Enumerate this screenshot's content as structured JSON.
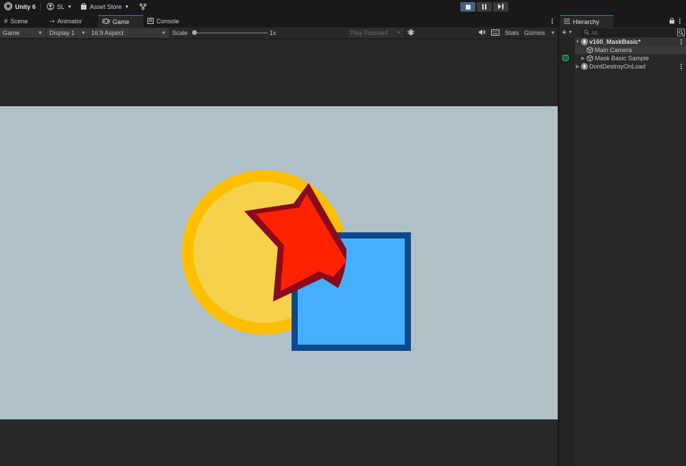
{
  "app": {
    "name": "Unity 6",
    "account": "SL",
    "asset_store": "Asset Store"
  },
  "playmode": {
    "buttons": [
      "stop",
      "pause",
      "step"
    ],
    "active": "stop"
  },
  "tabs": [
    {
      "label": "Scene",
      "icon": "grid-icon"
    },
    {
      "label": "Animator",
      "icon": "animator-icon"
    },
    {
      "label": "Game",
      "icon": "gamepad-icon",
      "active": true
    },
    {
      "label": "Console",
      "icon": "console-icon"
    }
  ],
  "game_toolbar": {
    "view_mode": "Game",
    "display": "Display 1",
    "aspect": "16:9 Aspect",
    "scale_label": "Scale",
    "scale_value": "1x",
    "play_focused": "Play Focused",
    "stats": "Stats",
    "gizmos": "Gizmos"
  },
  "scene_shapes": {
    "circle_color": "#f5d14c",
    "circle_outline": "#ffbf00",
    "star_color": "#ff2200",
    "star_outline": "#8a0a1e",
    "square_color": "#44b0fb",
    "square_outline": "#0e478a",
    "background": "#afc1c6"
  },
  "hierarchy": {
    "title": "Hierarchy",
    "search_placeholder": "All",
    "items": [
      {
        "label": "v160_MaskBasic*",
        "depth": 0,
        "expanded": true,
        "type": "scene"
      },
      {
        "label": "Main Camera",
        "depth": 1,
        "type": "gameobject"
      },
      {
        "label": "Mask Basic Sample",
        "depth": 1,
        "type": "gameobject",
        "collapsed": true
      },
      {
        "label": "DontDestroyOnLoad",
        "depth": 0,
        "collapsed": true,
        "type": "scene"
      }
    ]
  }
}
